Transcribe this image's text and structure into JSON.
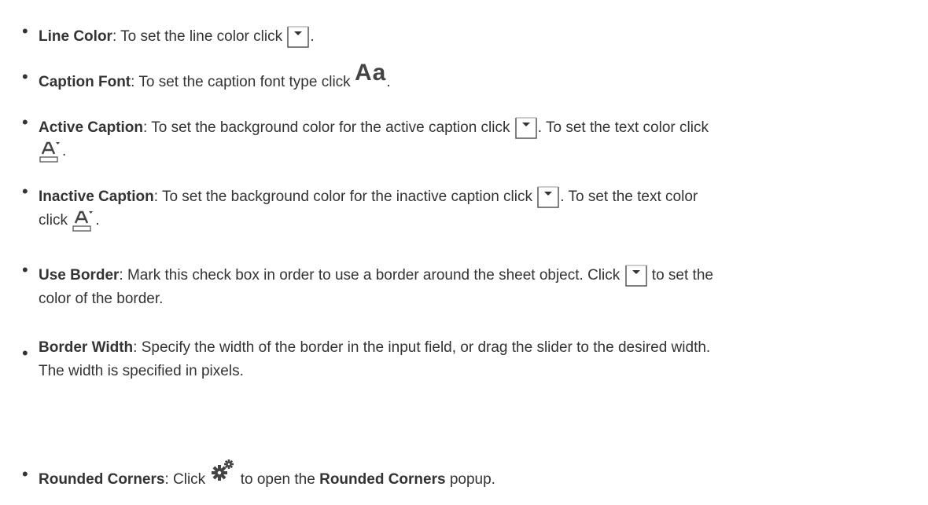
{
  "items": [
    {
      "label": "Line Color",
      "t1": ": To set the line color click ",
      "t2": "."
    },
    {
      "label": "Caption Font",
      "t1": ": To set the caption font type click ",
      "icon_text": "Aa",
      "t2": "."
    },
    {
      "label": "Active Caption",
      "t1": ": To set the background color for the active caption click ",
      "t2": ". To set the text color click",
      "t3": "."
    },
    {
      "label": "Inactive Caption",
      "t1": ": To set the background color for the inactive caption click ",
      "t2": ". To set the text color",
      "t3": "click ",
      "t4": "."
    },
    {
      "label": "Use Border",
      "t1": ": Mark this check box in order to use a border around the sheet object. Click ",
      "t2": " to set the",
      "t3": "color of the border."
    },
    {
      "label": "Border Width",
      "t1": ": Specify the width of the border in the input field, or drag the slider to the desired width.",
      "t2": "The width is specified in pixels."
    },
    {
      "label": "Rounded Corners",
      "t1": ": Click ",
      "t2": " to open the ",
      "bold2": "Rounded Corners",
      "t3": " popup."
    }
  ],
  "icons": {
    "color_dropdown": "color-dropdown-icon",
    "font": "font-icon",
    "text_color": "text-color-icon",
    "gear": "gear-icon"
  },
  "colors": {
    "text": "#333333",
    "icon": "#444444"
  }
}
